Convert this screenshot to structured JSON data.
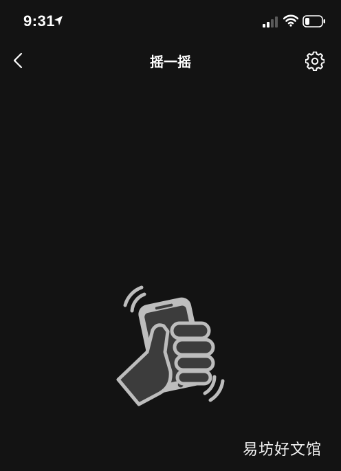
{
  "status_bar": {
    "time": "9:31",
    "icons": [
      "location-arrow-icon",
      "cellular-signal-icon",
      "wifi-icon",
      "battery-icon"
    ]
  },
  "nav": {
    "title": "摇一摇",
    "back_icon": "chevron-left-icon",
    "settings_icon": "gear-icon"
  },
  "main": {
    "illustration_icon": "hand-shaking-phone-icon"
  },
  "watermark": "易坊好文馆",
  "colors": {
    "background": "#131313",
    "text": "#ffffff",
    "illustration_dark": "#3c3c3c",
    "illustration_light": "#bdbdbd"
  }
}
